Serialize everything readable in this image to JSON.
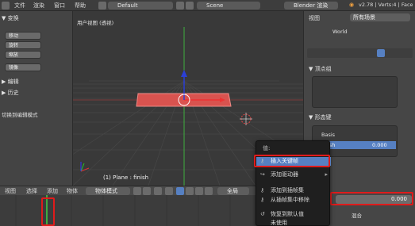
{
  "topbar": {
    "menus": [
      "文件",
      "渲染",
      "窗口",
      "帮助"
    ],
    "layout": "Default",
    "scene": "Scene",
    "engine": "Blender 渲染",
    "version": "v2.78 | Verts:4 | Face"
  },
  "toolbox": {
    "transform_header": "▼ 变换",
    "buttons": [
      "移动",
      "旋转",
      "缩放",
      "镜像"
    ],
    "edit_header": "▶ 编辑",
    "history_header": "▶ 历史",
    "toggle_mode": "切换到编辑模式"
  },
  "viewport": {
    "title": "用户视图 (透视)",
    "object_label": "(1) Plane : finish"
  },
  "header_bottom": {
    "items": [
      "视图",
      "选择",
      "添加",
      "物体"
    ],
    "mode": "物体模式",
    "global": "全局"
  },
  "props": {
    "view_label": "视图",
    "all_scenes": "所有场景",
    "world": "World",
    "vertex_groups": "▼ 顶点组",
    "shape_keys": "▼ 形态键",
    "basis": "Basis",
    "finish": "finish",
    "finish_value": "0.000",
    "value_field": "0.000",
    "blend_label": "混合"
  },
  "context_menu": {
    "title": "值:",
    "items": [
      {
        "label": "插入关键帧",
        "icon": "key-icon",
        "highlight": true,
        "arrow": false
      },
      {
        "label": "添加驱动器",
        "icon": "driver-icon",
        "highlight": false,
        "arrow": true
      },
      {
        "label": "添加到插帧集",
        "icon": "keyingset-add-icon",
        "highlight": false,
        "arrow": false
      },
      {
        "label": "从插帧集中移除",
        "icon": "keyingset-remove-icon",
        "highlight": false,
        "arrow": false
      },
      {
        "label": "恢复到默认值",
        "icon": "reset-icon",
        "highlight": false,
        "arrow": false
      },
      {
        "label": "未使用",
        "icon": "",
        "highlight": false,
        "arrow": false
      }
    ]
  },
  "colors": {
    "plane_fill": "#d9534f",
    "highlight": "#5680c2",
    "annotation_red": "#e01b1b",
    "axis_green": "#3fae3f",
    "axis_blue": "#2b3fd6"
  }
}
